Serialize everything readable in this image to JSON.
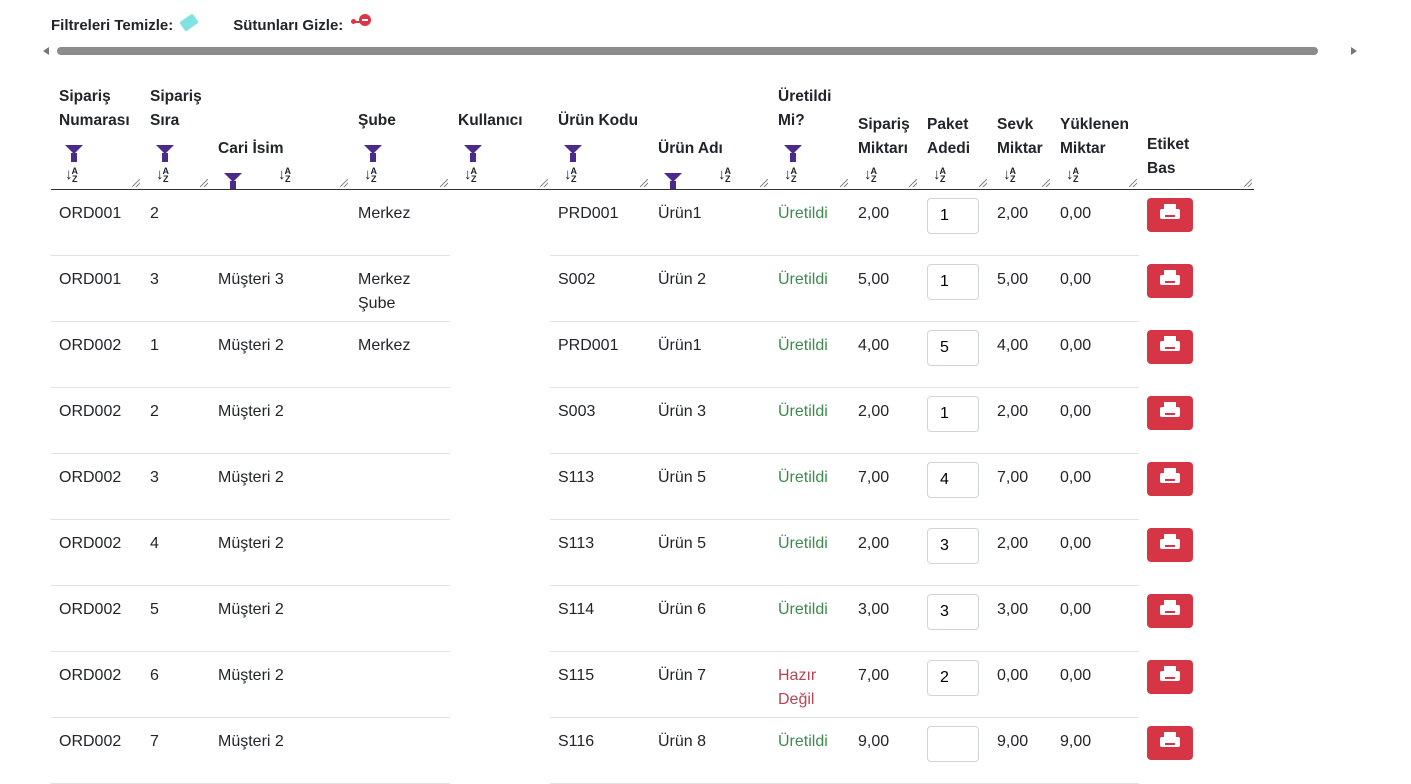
{
  "toolbar": {
    "clear_filters_label": "Filtreleri Temizle:",
    "clear_filters_icon": "eraser-icon",
    "hide_columns_label": "Sütunları Gizle:",
    "hide_columns_icon": "remove-circle-icon"
  },
  "columns": [
    {
      "key": "siparis_no",
      "lines": [
        "Sipariş",
        "Numarası"
      ],
      "filter": true,
      "sort": true
    },
    {
      "key": "siparis_sira",
      "lines": [
        "Sipariş",
        "Sıra"
      ],
      "filter": true,
      "sort": true
    },
    {
      "key": "cari_isim",
      "lines": [
        "Cari İsim"
      ],
      "filter": true,
      "sort": true
    },
    {
      "key": "sube",
      "lines": [
        "Şube"
      ],
      "filter": true,
      "sort": true
    },
    {
      "key": "kullanici",
      "lines": [
        "Kullanıcı"
      ],
      "filter": true,
      "sort": true
    },
    {
      "key": "urun_kodu",
      "lines": [
        "Ürün Kodu"
      ],
      "filter": true,
      "sort": true
    },
    {
      "key": "urun_adi",
      "lines": [
        "Ürün Adı"
      ],
      "filter": true,
      "sort": true
    },
    {
      "key": "uretildi",
      "lines": [
        "Üretildi",
        "Mi?"
      ],
      "filter": true,
      "sort": true
    },
    {
      "key": "siparis_miktar",
      "lines": [
        "Sipariş",
        "Miktarı"
      ],
      "filter": false,
      "sort": true
    },
    {
      "key": "paket_adedi",
      "lines": [
        "Paket",
        "Adedi"
      ],
      "filter": false,
      "sort": true
    },
    {
      "key": "sevk_miktar",
      "lines": [
        "Sevk",
        "Miktar"
      ],
      "filter": false,
      "sort": true
    },
    {
      "key": "yuklenen_miktar",
      "lines": [
        "Yüklenen",
        "Miktar"
      ],
      "filter": false,
      "sort": true
    },
    {
      "key": "etiket_bas",
      "lines": [
        "Etiket",
        "Bas"
      ],
      "filter": false,
      "sort": false
    }
  ],
  "sort_icon": "sort-alpha-down-icon",
  "filter_icon": "filter-icon",
  "print_icon": "printer-icon",
  "rows": [
    {
      "siparis_no": "ORD001",
      "siparis_sira": "2",
      "cari_isim": "",
      "sube": "Merkez",
      "kullanici": "",
      "urun_kodu": "PRD001",
      "urun_adi": "Ürün1",
      "uretildi": "Üretildi",
      "status": "ok",
      "siparis_miktar": "2,00",
      "paket_adedi": "1",
      "sevk_miktar": "2,00",
      "yuklenen_miktar": "0,00"
    },
    {
      "siparis_no": "ORD001",
      "siparis_sira": "3",
      "cari_isim": "Müşteri 3",
      "sube": "Merkez Şube",
      "kullanici": "",
      "urun_kodu": "S002",
      "urun_adi": "Ürün 2",
      "uretildi": "Üretildi",
      "status": "ok",
      "siparis_miktar": "5,00",
      "paket_adedi": "1",
      "sevk_miktar": "5,00",
      "yuklenen_miktar": "0,00"
    },
    {
      "siparis_no": "ORD002",
      "siparis_sira": "1",
      "cari_isim": "Müşteri 2",
      "sube": "Merkez",
      "kullanici": "",
      "urun_kodu": "PRD001",
      "urun_adi": "Ürün1",
      "uretildi": "Üretildi",
      "status": "ok",
      "siparis_miktar": "4,00",
      "paket_adedi": "5",
      "sevk_miktar": "4,00",
      "yuklenen_miktar": "0,00"
    },
    {
      "siparis_no": "ORD002",
      "siparis_sira": "2",
      "cari_isim": "Müşteri 2",
      "sube": "",
      "kullanici": "",
      "urun_kodu": "S003",
      "urun_adi": "Ürün 3",
      "uretildi": "Üretildi",
      "status": "ok",
      "siparis_miktar": "2,00",
      "paket_adedi": "1",
      "sevk_miktar": "2,00",
      "yuklenen_miktar": "0,00"
    },
    {
      "siparis_no": "ORD002",
      "siparis_sira": "3",
      "cari_isim": "Müşteri 2",
      "sube": "",
      "kullanici": "",
      "urun_kodu": "S113",
      "urun_adi": "Ürün 5",
      "uretildi": "Üretildi",
      "status": "ok",
      "siparis_miktar": "7,00",
      "paket_adedi": "4",
      "sevk_miktar": "7,00",
      "yuklenen_miktar": "0,00"
    },
    {
      "siparis_no": "ORD002",
      "siparis_sira": "4",
      "cari_isim": "Müşteri 2",
      "sube": "",
      "kullanici": "",
      "urun_kodu": "S113",
      "urun_adi": "Ürün 5",
      "uretildi": "Üretildi",
      "status": "ok",
      "siparis_miktar": "2,00",
      "paket_adedi": "3",
      "sevk_miktar": "2,00",
      "yuklenen_miktar": "0,00"
    },
    {
      "siparis_no": "ORD002",
      "siparis_sira": "5",
      "cari_isim": "Müşteri 2",
      "sube": "",
      "kullanici": "",
      "urun_kodu": "S114",
      "urun_adi": "Ürün 6",
      "uretildi": "Üretildi",
      "status": "ok",
      "siparis_miktar": "3,00",
      "paket_adedi": "3",
      "sevk_miktar": "3,00",
      "yuklenen_miktar": "0,00"
    },
    {
      "siparis_no": "ORD002",
      "siparis_sira": "6",
      "cari_isim": "Müşteri 2",
      "sube": "",
      "kullanici": "",
      "urun_kodu": "S115",
      "urun_adi": "Ürün 7",
      "uretildi": "Hazır Değil",
      "status": "bad",
      "siparis_miktar": "7,00",
      "paket_adedi": "2",
      "sevk_miktar": "0,00",
      "yuklenen_miktar": "0,00"
    },
    {
      "siparis_no": "ORD002",
      "siparis_sira": "7",
      "cari_isim": "Müşteri 2",
      "sube": "",
      "kullanici": "",
      "urun_kodu": "S116",
      "urun_adi": "Ürün 8",
      "uretildi": "Üretildi",
      "status": "ok",
      "siparis_miktar": "9,00",
      "paket_adedi": "",
      "sevk_miktar": "9,00",
      "yuklenen_miktar": "9,00"
    }
  ]
}
